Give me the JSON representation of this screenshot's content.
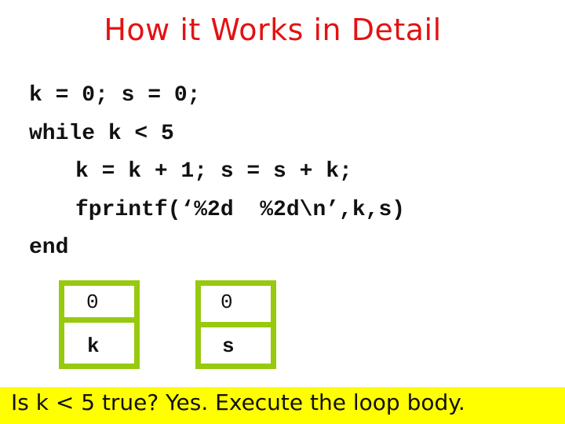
{
  "slide": {
    "title": "How it Works in Detail",
    "title_color": "#e31212",
    "code_lines": [
      "k = 0; s = 0;",
      "while k < 5",
      "k = k + 1; s = s + k;",
      "fprintf(‘%2d  %2d\\n’,k,s)",
      "end"
    ],
    "variables": [
      {
        "name": "k",
        "value": "0"
      },
      {
        "name": "s",
        "value": "0"
      }
    ],
    "box_border_color": "#97c90f",
    "status": {
      "text": "Is k < 5 true? Yes. Execute the loop body.",
      "background": "#ffff00"
    }
  }
}
